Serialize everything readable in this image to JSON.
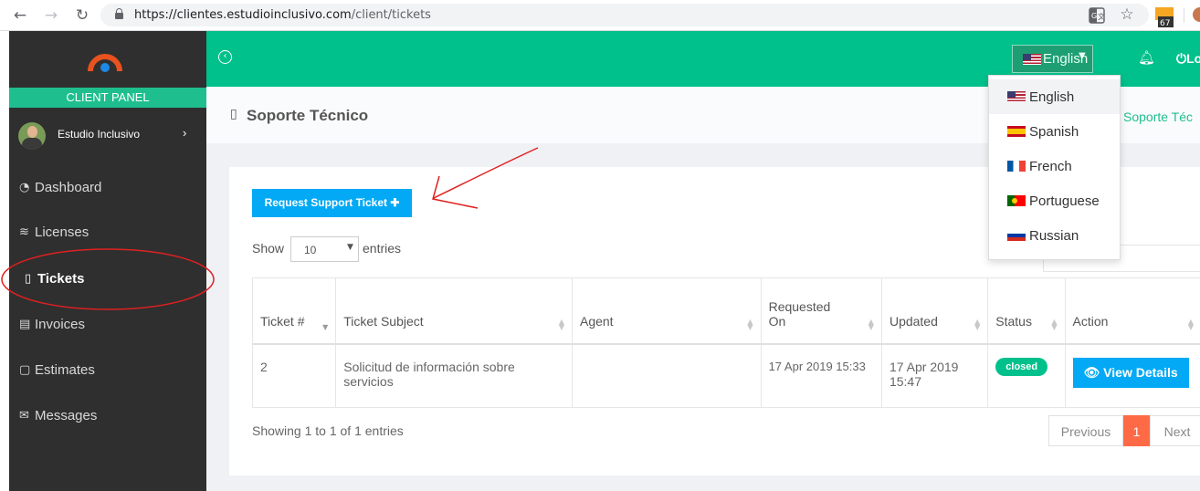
{
  "browser": {
    "url_host": "https://clientes.estudioinclusivo.com",
    "url_path": "/client/tickets",
    "ext_badge": "67"
  },
  "sidebar": {
    "panel_label": "CLIENT PANEL",
    "user_name": "Estudio Inclusivo",
    "items": [
      {
        "label": "Dashboard",
        "icon": "dashboard-icon"
      },
      {
        "label": "Licenses",
        "icon": "layers-icon"
      },
      {
        "label": "Tickets",
        "icon": "ticket-icon",
        "active": true
      },
      {
        "label": "Invoices",
        "icon": "invoice-icon"
      },
      {
        "label": "Estimates",
        "icon": "file-icon"
      },
      {
        "label": "Messages",
        "icon": "envelope-icon"
      }
    ]
  },
  "topbar": {
    "language_label": "English",
    "logout_label": "Lo"
  },
  "language_menu": {
    "options": [
      {
        "label": "English",
        "flag": "us-flag-icon"
      },
      {
        "label": "Spanish",
        "flag": "es-flag-icon"
      },
      {
        "label": "French",
        "flag": "fr-flag-icon"
      },
      {
        "label": "Portuguese",
        "flag": "pt-flag-icon"
      },
      {
        "label": "Russian",
        "flag": "ru-flag-icon"
      }
    ]
  },
  "page": {
    "title": "Soporte Técnico",
    "breadcrumb": "Soporte Téc"
  },
  "tickets": {
    "request_button": "Request Support Ticket ✚",
    "show_label": "Show",
    "entries_value": "10",
    "entries_label": "entries",
    "columns": [
      "Ticket #",
      "Ticket Subject",
      "Agent",
      "Requested On",
      "Updated",
      "Status",
      "Action"
    ],
    "rows": [
      {
        "ticket": "2",
        "subject": "Solicitud de información sobre servicios",
        "agent": "",
        "requested": "17 Apr 2019 15:33",
        "updated": "17 Apr 2019 15:47",
        "status": "closed",
        "action": "👁 View Details"
      }
    ],
    "info": "Showing 1 to 1 of 1 entries",
    "pagination": {
      "previous": "Previous",
      "current": "1",
      "next": "Next"
    }
  },
  "colors": {
    "accent_green": "#00c08b",
    "sidebar_bg": "#2f2f2f",
    "button_blue": "#03a9f4",
    "page_active": "#ff6a46",
    "annotation_red": "#e02020"
  }
}
